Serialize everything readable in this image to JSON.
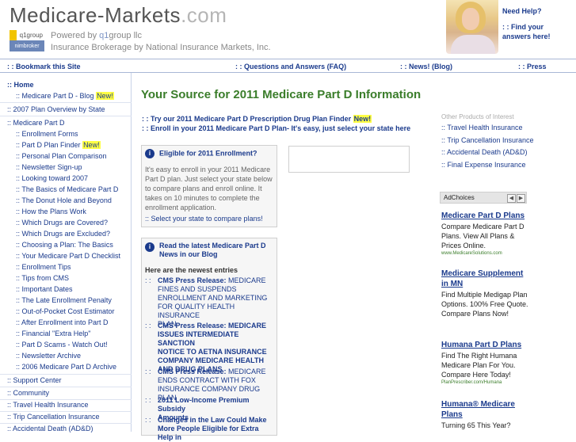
{
  "header": {
    "logo_main": "Medicare-Markets",
    "logo_com": ".com",
    "logo_badge_top": "q1group",
    "logo_badge_bottom": "nimbroker",
    "powered_prefix": "Powered by ",
    "powered_brand": "q1",
    "powered_suffix": "group llc",
    "brokerage": "Insurance Brokerage by National Insurance Markets, Inc.",
    "need_help": "Need Help?",
    "find_answers_line1": ": : Find your",
    "find_answers_line2": "answers here!"
  },
  "topnav": {
    "bookmark": ": : Bookmark this Site",
    "faq": ": : Questions and Answers (FAQ)",
    "news": ": : News! (Blog)",
    "press": ": : Press"
  },
  "sidebar": {
    "items": [
      ":: Home",
      ":: Medicare Part D - Blog",
      ":: 2007 Plan Overview by State",
      ":: Medicare Part D",
      ":: Enrollment Forms",
      ":: Part D Plan Finder",
      ":: Personal Plan Comparison",
      ":: Newsletter Sign-up",
      ":: Looking toward 2007",
      ":: The Basics of Medicare Part D",
      ":: The Donut Hole and Beyond",
      ":: How the Plans Work",
      ":: Which Drugs are Covered?",
      ":: Which Drugs are Excluded?",
      ":: Choosing a Plan: The Basics",
      ":: Your Medicare Part D Checklist",
      ":: Enrollment Tips",
      ":: Tips from CMS",
      ":: Important Dates",
      ":: The Late Enrollment Penalty",
      ":: Out-of-Pocket Cost Estimator",
      ":: After Enrollment into Part D",
      ":: Financial \"Extra Help\"",
      ":: Part D Scams - Watch Out!",
      ":: Newsletter Archive",
      ":: 2006 Medicare Part D Archive",
      ":: Support Center",
      ":: Community",
      ":: Travel Health Insurance",
      ":: Trip Cancellation Insurance",
      ":: Accidental Death (AD&D)"
    ],
    "new_badge": "New!"
  },
  "main": {
    "title": "Your Source for 2011 Medicare Part D Information",
    "intro_line1": ": : Try our 2011 Medicare Part D Prescription Drug Plan Finder",
    "intro_line2": ": : Enroll in your 2011 Medicare Part D Plan- It's easy, just select your state here",
    "new_badge": "New!",
    "eligible": {
      "header": "Eligible for 2011 Enrollment?",
      "text": [
        "It's easy to enroll in your 2011 Medicare",
        "Part D plan. Just select your state below",
        "to compare plans and enroll online. It",
        "takes on 10 minutes to complete the",
        "enrollment application."
      ],
      "link": ":: Select your state to compare plans!"
    },
    "blog": {
      "header_line1": "Read the latest Medicare Part D",
      "header_line2": "News in our Blog",
      "subheader": "Here are the newest entries",
      "entries": [
        {
          "bold": "CMS Press Release:",
          "rest": [
            " MEDICARE",
            "FINES AND SUSPENDS",
            "ENROLLMENT AND MARKETING",
            "FOR QUALITY HEALTH INSURANCE",
            "PLAN"
          ]
        },
        {
          "bold": "CMS Press Release: MEDICARE",
          "rest": [
            "ISSUES INTERMEDIATE SANCTION",
            "NOTICE TO AETNA INSURANCE",
            "COMPANY MEDICARE HEALTH",
            "AND DRUG PLANS"
          ]
        },
        {
          "bold": "CMS Press Release:",
          "rest": [
            " MEDICARE",
            "ENDS CONTRACT WITH FOX",
            "INSURANCE COMPANY DRUG PLAN"
          ]
        },
        {
          "bold": "2011 Low-Income Premium Subsidy",
          "rest": [
            "Amounts"
          ]
        },
        {
          "bold": "Changes in the Law Could Make",
          "rest": [
            "More People Eligible for Extra Help in"
          ]
        }
      ],
      "bullet": ": :"
    }
  },
  "right": {
    "other_header": "Other Products of Interest",
    "other_items": [
      ":: Travel Health Insurance",
      ":: Trip Cancellation Insurance",
      ":: Accidental Death (AD&D)",
      ":: Final Expense Insurance"
    ],
    "adchoices": "AdChoices",
    "ads": [
      {
        "title": "Medicare Part D Plans",
        "desc": "Compare Medicare Part D Plans. View All Plans & Prices Online.",
        "url": "www.MedicareSolutions.com"
      },
      {
        "title": "Medicare Supplement in MN",
        "desc": "Find Multiple Medigap Plan Options. 100% Free Quote. Compare Plans Now!",
        "url": ""
      },
      {
        "title": "Humana Part D Plans",
        "desc": "Find The Right Humana Medicare Plan For You. Compare Here Today!",
        "url": "PlanPrescriber.com/Humana"
      },
      {
        "title": "Humana® Medicare Plans",
        "desc": "Turning 65 This Year?",
        "url": ""
      }
    ]
  },
  "colors": {
    "title_green": "#3a7d2a",
    "link_blue": "#1a3a8c",
    "new_yellow": "#ffff44"
  }
}
